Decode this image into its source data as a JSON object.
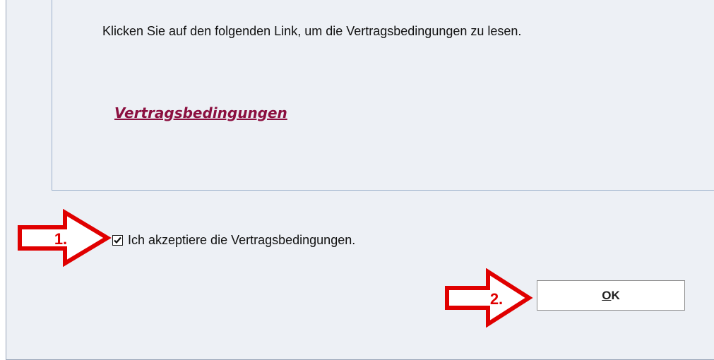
{
  "terms_box": {
    "instruction_text": "Klicken Sie auf den folgenden Link, um die Vertragsbedingungen zu lesen.",
    "terms_link_text": "Vertragsbedingungen"
  },
  "acceptance": {
    "checked": true,
    "label": "Ich akzeptiere die Vertragsbedingungen."
  },
  "ok_button": {
    "mnemonic": "O",
    "rest": "K"
  },
  "annotations": {
    "step1_label": "1.",
    "step2_label": "2.",
    "arrow_color": "#e00000"
  },
  "colors": {
    "background": "#edf0f5",
    "link": "#8b0f3f"
  }
}
